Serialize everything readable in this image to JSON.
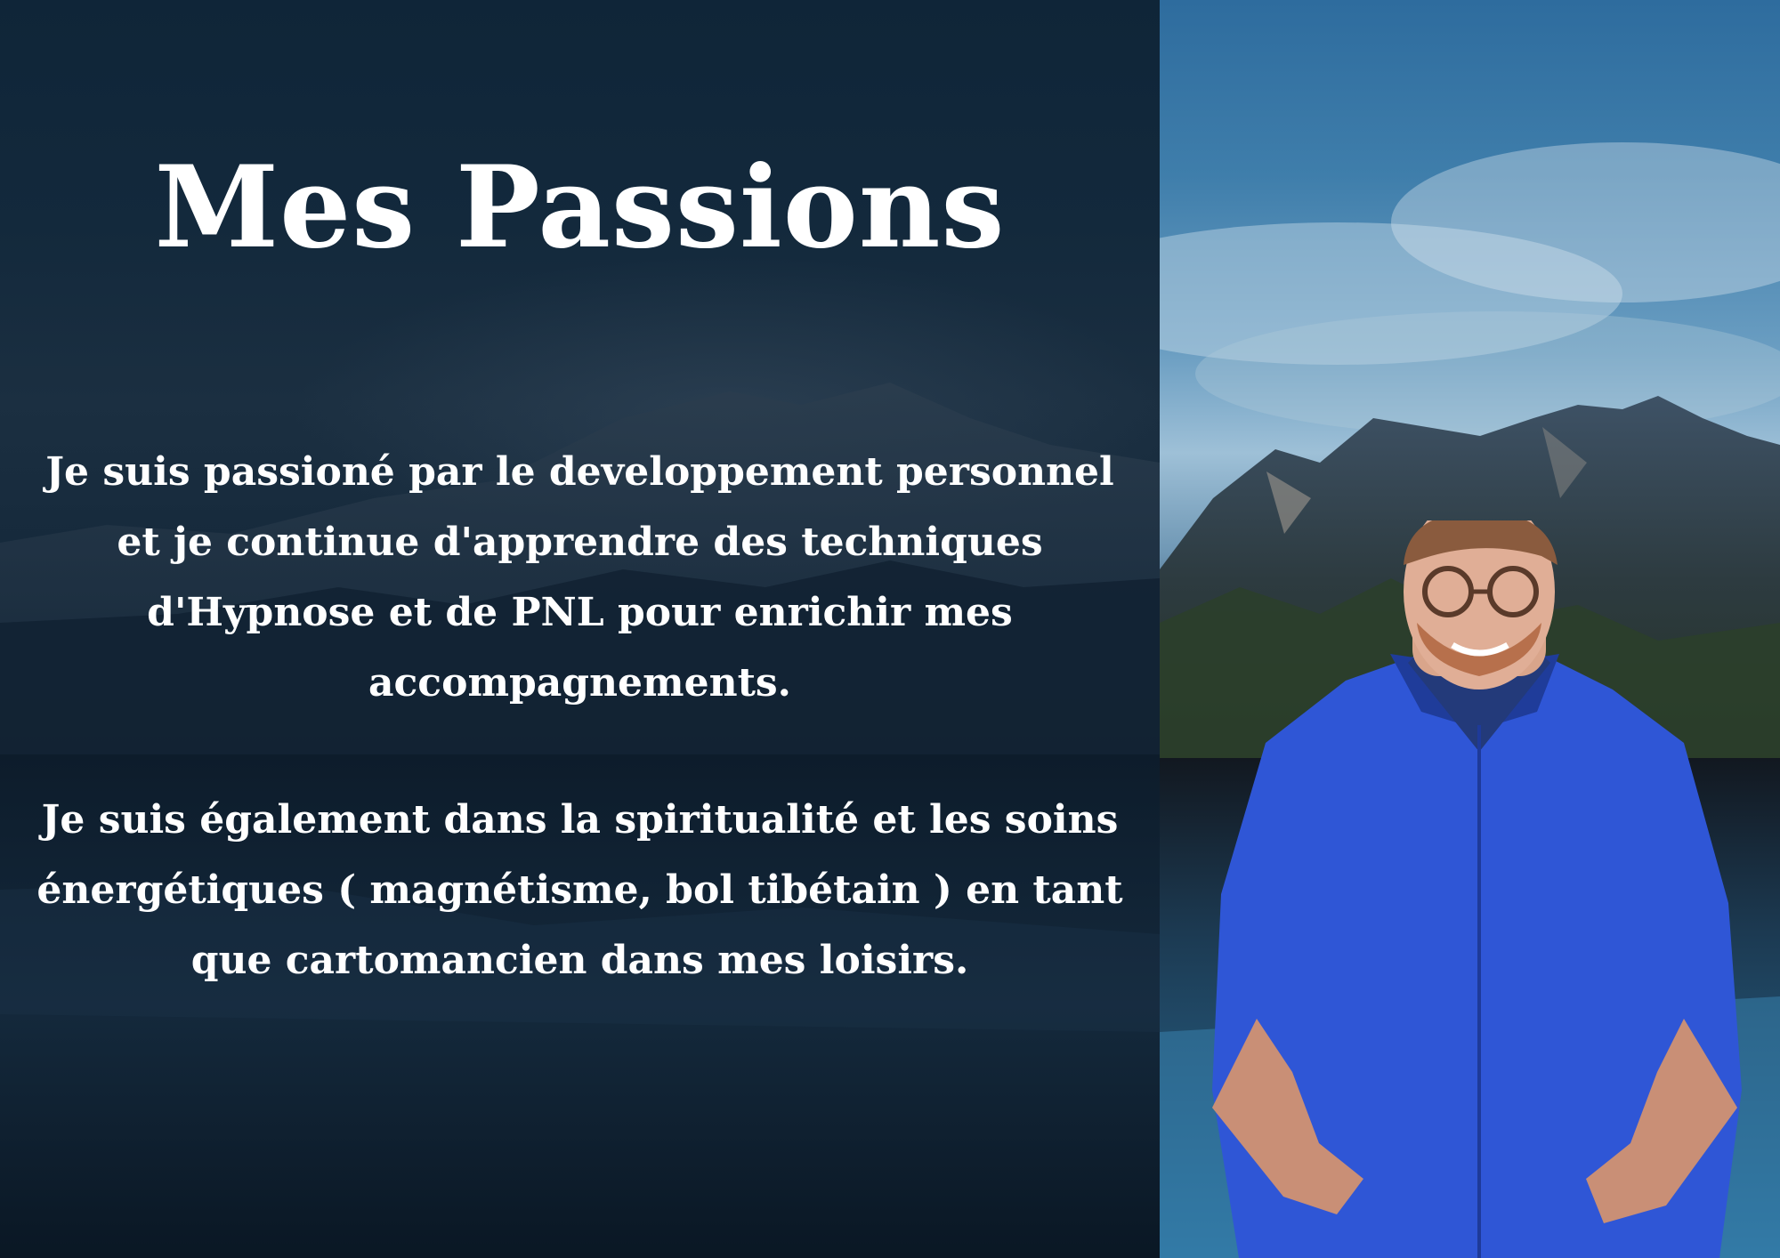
{
  "title": "Mes Passions",
  "paragraphs": [
    {
      "lines": [
        "Je suis passioné par le developpement personnel",
        "et je continue d'apprendre des techniques",
        "d'Hypnose et de PNL pour enrichir mes",
        "accompagnements."
      ]
    },
    {
      "lines": [
        "Je suis également dans la spiritualité  et les soins",
        "énergétiques ( magnétisme, bol tibétain ) en tant",
        "que cartomancien dans mes loisirs."
      ]
    }
  ],
  "images": {
    "left_background": "dark-mountain-lake-background",
    "right_background": "mountain-lake-photo",
    "portrait": "man-in-blue-sweater-with-glasses"
  },
  "colors": {
    "text": "#ffffff",
    "left_panel": "#13293c",
    "sky": "#4a86b3",
    "sweater": "#2f56d6"
  }
}
